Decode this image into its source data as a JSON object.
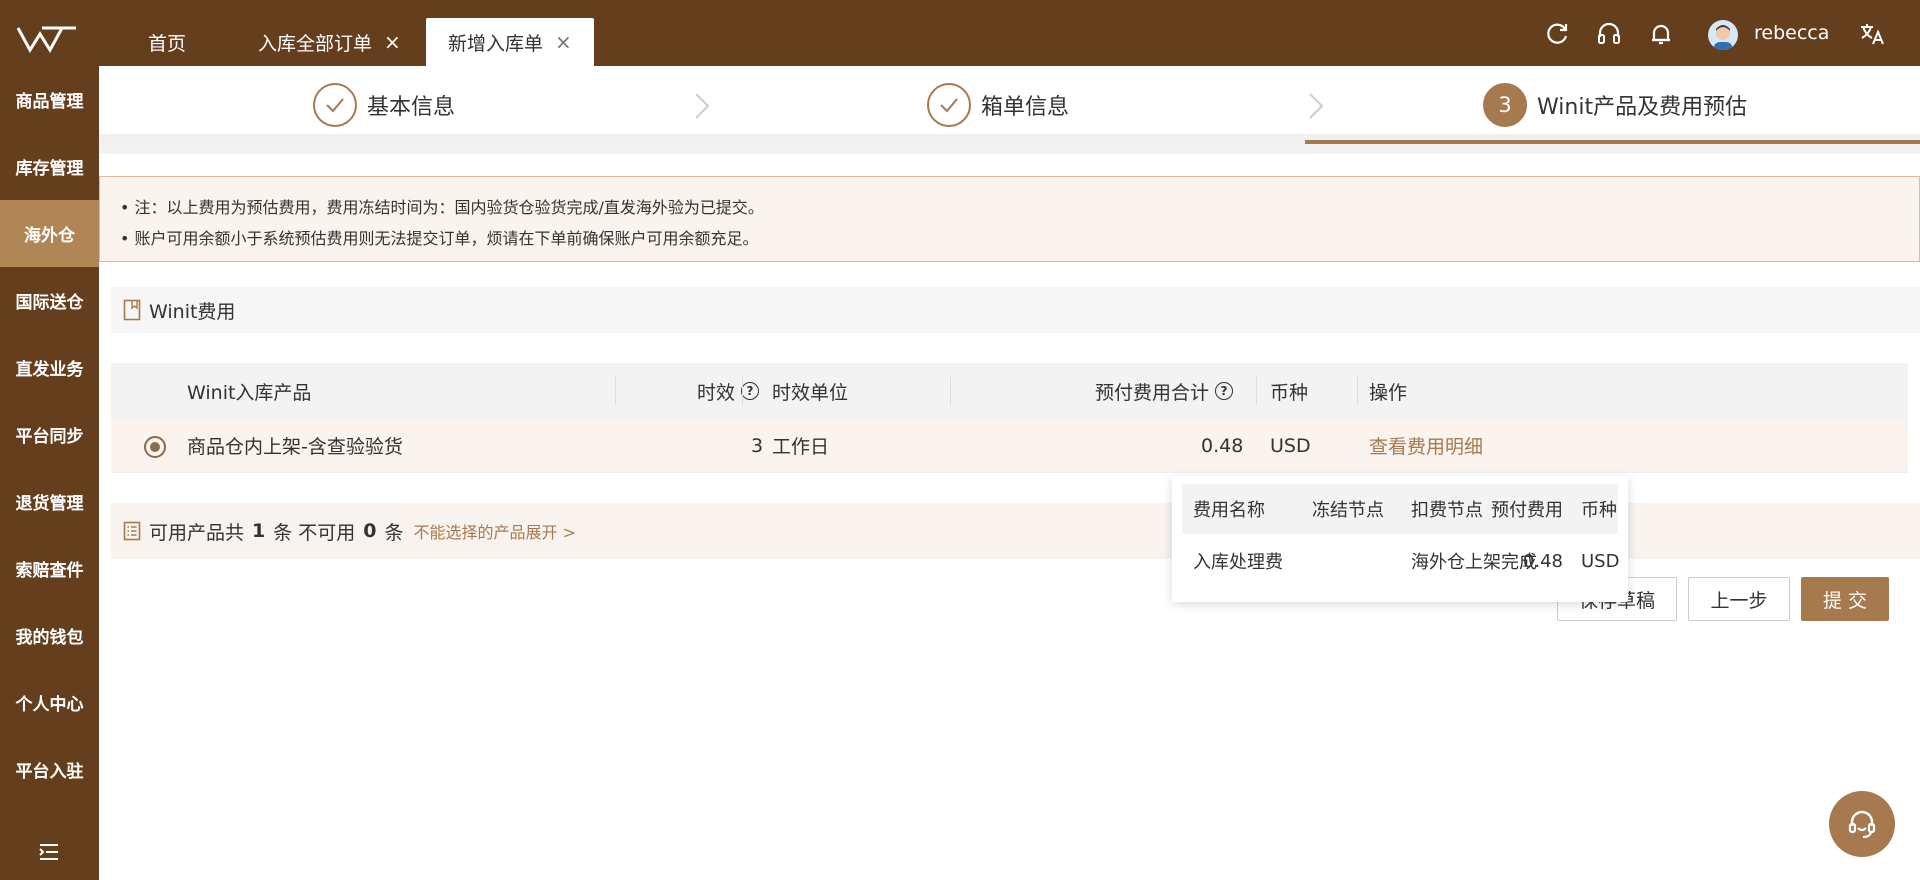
{
  "topbar": {
    "tabs": [
      {
        "label": "首页"
      },
      {
        "label": "入库全部订单",
        "close": "×"
      },
      {
        "label": "新增入库单",
        "close": "×"
      }
    ],
    "icons": [
      "refresh-icon",
      "headset-icon",
      "bell-icon",
      "translate-icon"
    ],
    "user": {
      "name": "rebecca"
    }
  },
  "sidebar": {
    "items": [
      {
        "label": "商品管理"
      },
      {
        "label": "库存管理"
      },
      {
        "label": "海外仓",
        "active": true
      },
      {
        "label": "国际送仓"
      },
      {
        "label": "直发业务"
      },
      {
        "label": "平台同步"
      },
      {
        "label": "退货管理"
      },
      {
        "label": "索赔查件"
      },
      {
        "label": "我的钱包"
      },
      {
        "label": "个人中心"
      },
      {
        "label": "平台入驻"
      }
    ]
  },
  "steps": [
    {
      "label": "基本信息",
      "status": "done"
    },
    {
      "label": "箱单信息",
      "status": "done"
    },
    {
      "number": "3",
      "label": "Winit产品及费用预估",
      "status": "active"
    }
  ],
  "notice": {
    "lines": [
      "• 注：以上费用为预估费用，费用冻结时间为：国内验货仓验货完成/直发海外验为已提交。",
      "• 账户可用余额小于系统预估费用则无法提交订单，烦请在下单前确保账户可用余额充足。"
    ]
  },
  "fee_section": {
    "title": "Winit费用"
  },
  "table": {
    "headers": {
      "product": "Winit入库产品",
      "timeliness": "时效",
      "unit": "时效单位",
      "total": "预付费用合计",
      "currency": "币种",
      "action": "操作"
    },
    "rows": [
      {
        "product": "商品仓内上架-含查验验货",
        "timeliness": "3",
        "unit": "工作日",
        "total": "0.48",
        "currency": "USD",
        "action": "查看费用明细",
        "selected": true
      }
    ]
  },
  "availability": {
    "prefix": "可用产品共",
    "available": "1",
    "middle": "条 不可用",
    "unavailable": "0",
    "suffix": "条",
    "expand": "不能选择的产品展开 >"
  },
  "popover": {
    "headers": {
      "name": "费用名称",
      "freeze": "冻结节点",
      "deduct": "扣费节点",
      "prepaid": "预付费用",
      "currency": "币种"
    },
    "rows": [
      {
        "name": "入库处理费",
        "freeze": "",
        "deduct": "海外仓上架完成",
        "prepaid": "0.48",
        "currency": "USD"
      }
    ]
  },
  "buttons": {
    "save_draft": "保存草稿",
    "prev": "上一步",
    "submit": "提 交"
  },
  "colors": {
    "sidebar": "#653e1e",
    "accent": "#a67a4e",
    "active_sidebar": "#b08656",
    "notice_bg": "#fbf3ee"
  }
}
